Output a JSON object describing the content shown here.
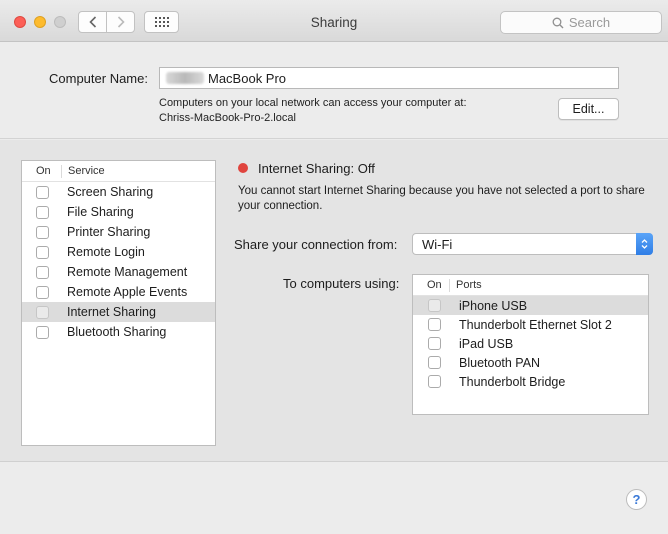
{
  "window": {
    "title": "Sharing",
    "search_placeholder": "Search"
  },
  "computer_name": {
    "label": "Computer Name:",
    "value": "MacBook Pro",
    "note_line1": "Computers on your local network can access your computer at:",
    "note_line2": "Chriss-MacBook-Pro-2.local",
    "edit_label": "Edit..."
  },
  "services": {
    "col_on": "On",
    "col_service": "Service",
    "items": [
      {
        "label": "Screen Sharing"
      },
      {
        "label": "File Sharing"
      },
      {
        "label": "Printer Sharing"
      },
      {
        "label": "Remote Login"
      },
      {
        "label": "Remote Management"
      },
      {
        "label": "Remote Apple Events"
      },
      {
        "label": "Internet Sharing"
      },
      {
        "label": "Bluetooth Sharing"
      }
    ],
    "selected_index": 6
  },
  "internet_sharing": {
    "status": "Internet Sharing: Off",
    "status_color": "#e0443e",
    "message": "You cannot start Internet Sharing because you have not selected a port to share your connection.",
    "share_from_label": "Share your connection from:",
    "share_from_value": "Wi-Fi",
    "to_label": "To computers using:",
    "col_on": "On",
    "col_ports": "Ports",
    "ports": [
      {
        "label": "iPhone USB"
      },
      {
        "label": "Thunderbolt Ethernet Slot 2"
      },
      {
        "label": "iPad USB"
      },
      {
        "label": "Bluetooth PAN"
      },
      {
        "label": "Thunderbolt Bridge"
      }
    ]
  },
  "help_label": "?"
}
